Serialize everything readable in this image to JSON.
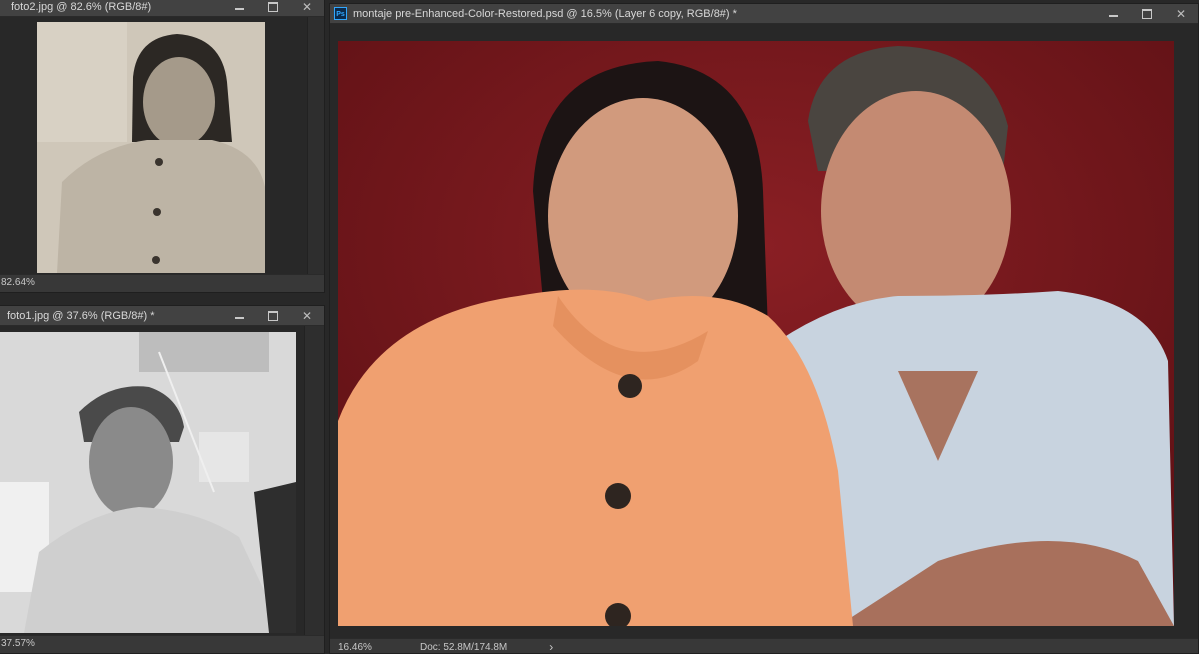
{
  "windows": {
    "foto2": {
      "title": "foto2.jpg @ 82.6% (RGB/8#)",
      "zoom": "82.64%"
    },
    "foto1": {
      "title": "foto1.jpg @ 37.6% (RGB/8#) *",
      "zoom": "37.57%"
    },
    "main": {
      "app_icon": "Ps",
      "title": "montaje pre-Enhanced-Color-Restored.psd @ 16.5% (Layer 6 copy, RGB/8#) *",
      "zoom": "16.46%",
      "doc_info": "Doc: 52.8M/174.8M",
      "status_arrow": "›"
    }
  },
  "controls": {
    "close_glyph": "✕"
  },
  "colors": {
    "panel": "#383838",
    "background": "#282828",
    "canvas_red": "#6e1418"
  }
}
